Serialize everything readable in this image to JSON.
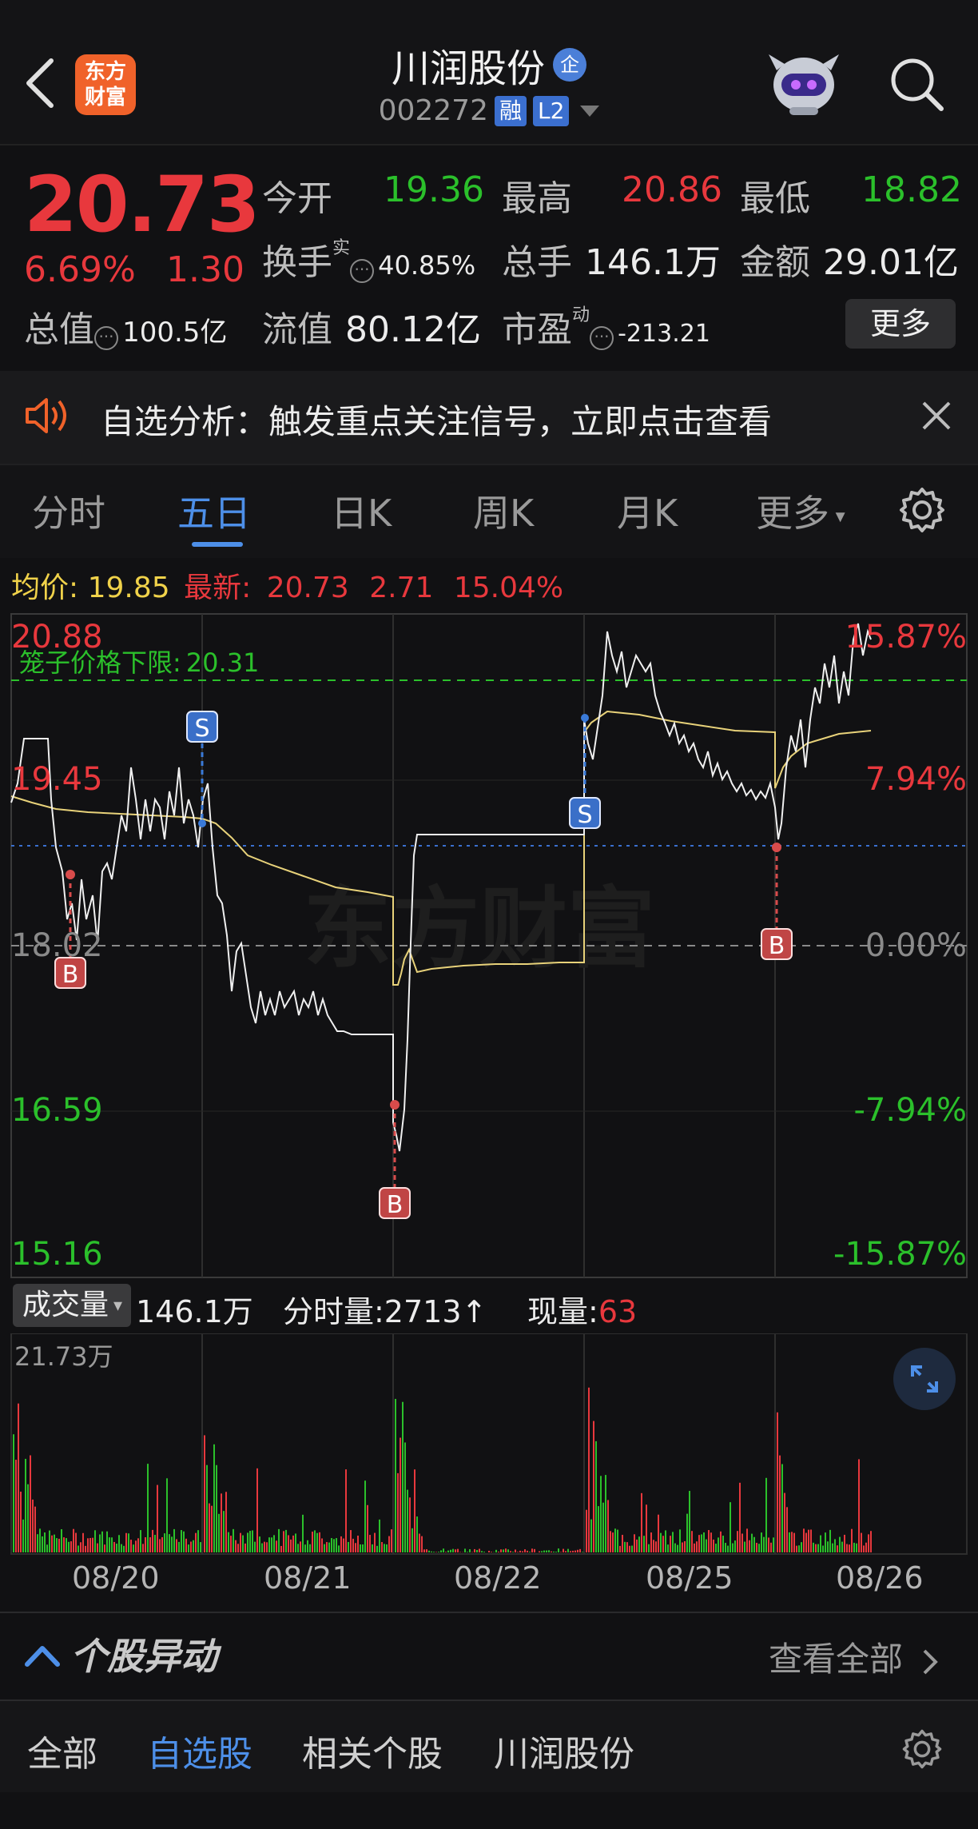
{
  "header": {
    "logo_line1": "东方",
    "logo_line2": "财富",
    "stock_name": "川润股份",
    "qi_badge": "企",
    "stock_code": "002272",
    "tag_margin": "融",
    "tag_level": "L2"
  },
  "quote": {
    "price": "20.73",
    "change_pct": "6.69%",
    "change_amt": "1.30",
    "open_label": "今开",
    "open_value": "19.36",
    "high_label": "最高",
    "high_value": "20.86",
    "low_label": "最低",
    "low_value": "18.82",
    "turnover_label": "换手",
    "turnover_sup": "实",
    "turnover_value": "40.85%",
    "volume_label": "总手",
    "volume_value": "146.1万",
    "amount_label": "金额",
    "amount_value": "29.01亿",
    "mktcap_label": "总值",
    "mktcap_value": "100.5亿",
    "float_label": "流值",
    "float_value": "80.12亿",
    "pe_label": "市盈",
    "pe_sup": "动",
    "pe_value": "-213.21",
    "more_label": "更多"
  },
  "notice": {
    "text": "自选分析：触发重点关注信号，立即点击查看"
  },
  "tabs": [
    {
      "label": "分时"
    },
    {
      "label": "五日"
    },
    {
      "label": "日K"
    },
    {
      "label": "周K"
    },
    {
      "label": "月K"
    },
    {
      "label": "更多"
    }
  ],
  "avg_row": {
    "avg_label": "均价:",
    "avg_value": "19.85",
    "latest_label": "最新:",
    "latest_value": "20.73",
    "latest_change": "2.71",
    "latest_pct": "15.04%"
  },
  "chart": {
    "cage_label": "笼子价格下限:",
    "cage_value": "20.31",
    "left_axis": [
      "20.88",
      "19.45",
      "18.02",
      "16.59",
      "15.16"
    ],
    "right_axis": [
      "15.87%",
      "7.94%",
      "0.00%",
      "-7.94%",
      "-15.87%"
    ],
    "watermark": "东方财富",
    "markers": [
      "S",
      "B",
      "B",
      "S",
      "B"
    ]
  },
  "volume": {
    "label": "成交量",
    "total": "146.1万",
    "tick_label": "分时量:2713",
    "arrow": "↑",
    "current_label": "现量:",
    "current_value": "63",
    "max_label": "21.73万"
  },
  "dates": [
    "08/20",
    "08/21",
    "08/22",
    "08/25",
    "08/26"
  ],
  "footer": {
    "anomaly_title": "个股异动",
    "view_all": "查看全部",
    "bottom_tabs": [
      "全部",
      "自选股",
      "相关个股",
      "川润股份"
    ]
  },
  "chart_data": {
    "type": "line",
    "x": [
      "08/20",
      "08/21",
      "08/22",
      "08/25",
      "08/26"
    ],
    "y_range": [
      15.16,
      20.88
    ],
    "prev_close": 18.02,
    "series": [],
    "reference_lines": [
      {
        "value": 20.31,
        "label": "笼子价格下限:"
      }
    ]
  }
}
